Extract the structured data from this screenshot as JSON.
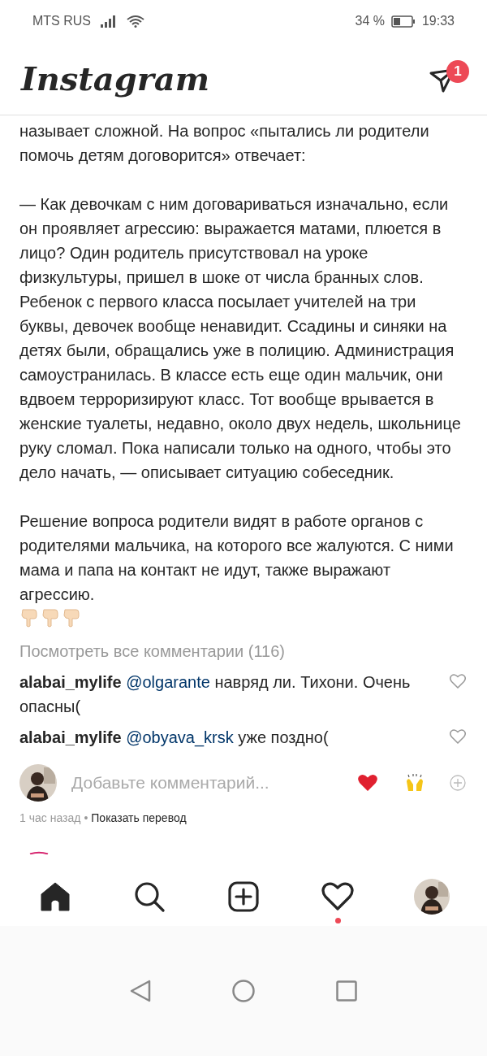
{
  "status_bar": {
    "carrier": "MTS RUS",
    "battery": "34 %",
    "time": "19:33"
  },
  "header": {
    "logo": "Instagram",
    "direct_badge": "1"
  },
  "caption": {
    "paragraphs": [
      "называет сложной. На вопрос «пытались ли родители помочь детям договорится» отвечает:",
      "— Как девочкам с ним договариваться изначально, если он проявляет агрессию: выражается матами, плюется в лицо? Один родитель присутствовал на уроке физкультуры, пришел в шоке от числа бранных слов. Ребенок с первого класса посылает учителей на три буквы, девочек вообще ненавидит. Ссадины и синяки на детях были, обращались уже в полицию. Администрация самоустранилась. В классе есть еще один мальчик, они вдвоем терроризируют класс. Тот вообще врывается в женские туалеты, недавно, около двух недель, школьнице руку сломал. Пока написали только на одного, чтобы это дело начать, — описывает ситуацию собеседник.",
      "Решение вопроса родители видят в работе органов с родителями мальчика, на которого все жалуются. С ними мама и папа на контакт не идут, также выражают агрессию."
    ]
  },
  "view_all_comments": "Посмотреть все комментарии (116)",
  "comments": [
    {
      "user": "alabai_mylife",
      "mention": "@olgarante",
      "text": "навряд ли. Тихони. Очень опасны("
    },
    {
      "user": "alabai_mylife",
      "mention": "@obyava_krsk",
      "text": "уже поздно("
    }
  ],
  "add_comment": {
    "placeholder": "Добавьте комментарий..."
  },
  "meta": {
    "time": "1 час назад",
    "separator": "•",
    "translate": "Показать перевод"
  },
  "bottom_nav": [
    {
      "kind": "home",
      "selected": true
    },
    {
      "kind": "search",
      "selected": false
    },
    {
      "kind": "add",
      "selected": false
    },
    {
      "kind": "activity",
      "selected": false,
      "dot": true
    },
    {
      "kind": "profile",
      "selected": false
    }
  ]
}
